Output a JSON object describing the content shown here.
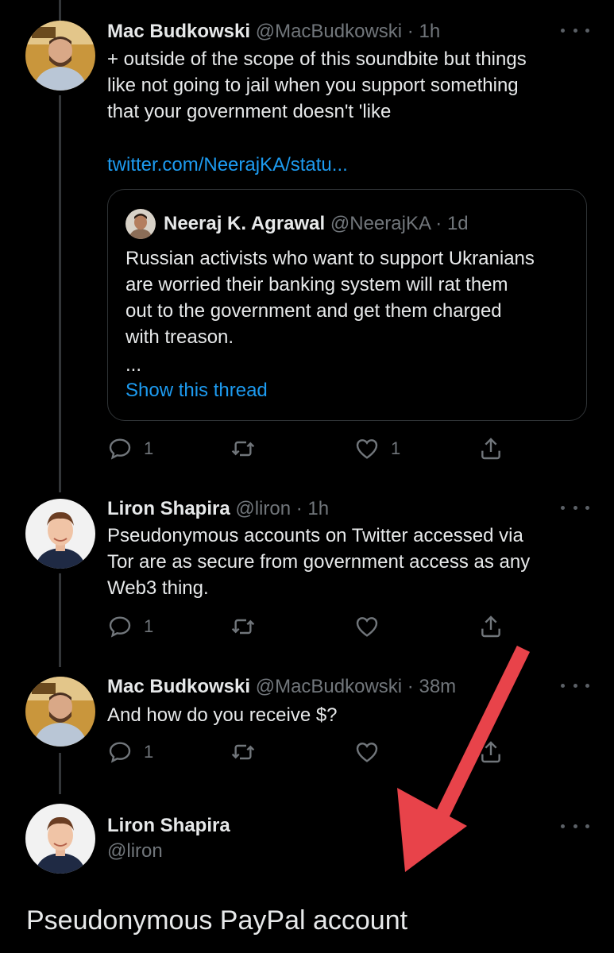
{
  "tweets": [
    {
      "name": "Mac Budkowski",
      "meta": "@MacBudkowski · 1h",
      "text_lines": [
        "+ outside of the scope of this soundbite but things",
        "like not going to jail when you support something",
        "that your government doesn't 'like"
      ],
      "link": "twitter.com/NeerajKA/statu...",
      "quote": {
        "name": "Neeraj K. Agrawal",
        "meta": "@NeerajKA · 1d",
        "text_lines": [
          "Russian activists who want to support Ukranians",
          "are worried their banking system will rat them",
          "out to the government and get them charged",
          "with treason.",
          "..."
        ],
        "show_thread": "Show this thread"
      },
      "reply_count": "1",
      "like_count": "1"
    },
    {
      "name": "Liron Shapira",
      "meta": "@liron · 1h",
      "text_lines": [
        "Pseudonymous accounts on Twitter accessed via",
        "Tor are as secure from government access as any",
        "Web3 thing."
      ],
      "reply_count": "1"
    },
    {
      "name": "Mac Budkowski",
      "meta": "@MacBudkowski · 38m",
      "text_lines": [
        "And how do you receive $?"
      ],
      "reply_count": "1"
    }
  ],
  "reply": {
    "name": "Liron Shapira",
    "handle": "@liron",
    "text": "Pseudonymous PayPal account"
  },
  "colors": {
    "background": "#000000",
    "link": "#1d9bf0",
    "muted": "#71767b",
    "annotation_arrow": "#e8434a"
  },
  "icons": [
    "reply-icon",
    "retweet-icon",
    "like-icon",
    "share-icon",
    "more-icon"
  ]
}
